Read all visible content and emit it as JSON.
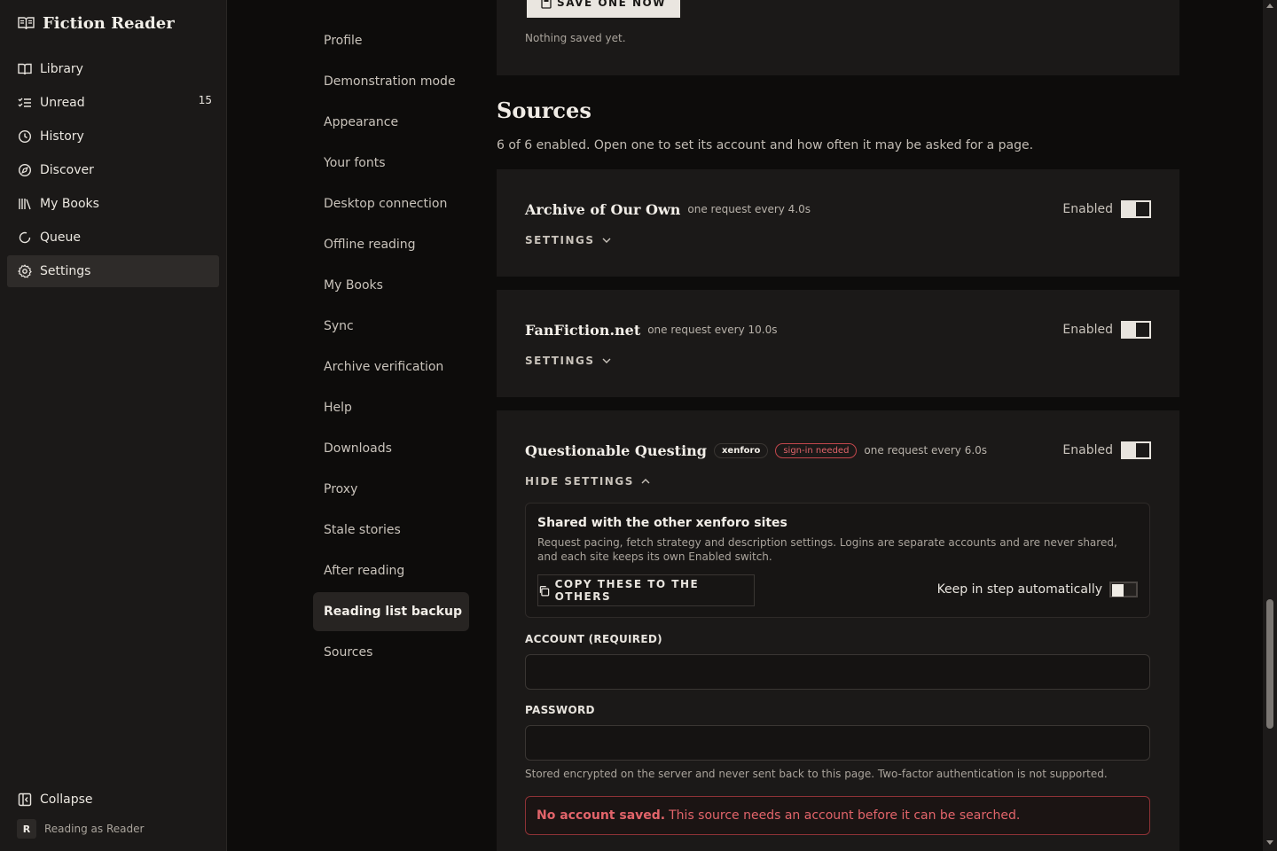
{
  "app": {
    "title": "Fiction Reader"
  },
  "sidebar": {
    "items": [
      {
        "label": "Library",
        "icon": "book-open-icon"
      },
      {
        "label": "Unread",
        "icon": "list-check-icon",
        "count": "15"
      },
      {
        "label": "History",
        "icon": "clock-icon"
      },
      {
        "label": "Discover",
        "icon": "compass-icon"
      },
      {
        "label": "My Books",
        "icon": "bookshelf-icon"
      },
      {
        "label": "Queue",
        "icon": "refresh-icon"
      },
      {
        "label": "Settings",
        "icon": "gear-icon",
        "active": true
      }
    ],
    "collapse_label": "Collapse",
    "user_initial": "R",
    "reading_as": "Reading as Reader"
  },
  "settings_nav": {
    "items": [
      "Profile",
      "Demonstration mode",
      "Appearance",
      "Your fonts",
      "Desktop connection",
      "Offline reading",
      "My Books",
      "Sync",
      "Archive verification",
      "Help",
      "Downloads",
      "Proxy",
      "Stale stories",
      "After reading",
      "Reading list backup",
      "Sources"
    ],
    "active": "Reading list backup"
  },
  "backup": {
    "save_button": "SAVE ONE NOW",
    "status": "Nothing saved yet."
  },
  "sources": {
    "title": "Sources",
    "description": "6 of 6 enabled. Open one to set its account and how often it may be asked for a page.",
    "enabled_label": "Enabled",
    "list": [
      {
        "name": "Archive of Our Own",
        "rate": "one request every 4.0s",
        "settings_label": "SETTINGS",
        "enabled": true
      },
      {
        "name": "FanFiction.net",
        "rate": "one request every 10.0s",
        "settings_label": "SETTINGS",
        "enabled": true
      },
      {
        "name": "Questionable Questing",
        "tag": "xenforo",
        "warning": "sign-in needed",
        "rate": "one request every 6.0s",
        "settings_label": "HIDE SETTINGS",
        "enabled": true
      }
    ],
    "shared": {
      "title": "Shared with the other xenforo sites",
      "description": "Request pacing, fetch strategy and description settings. Logins are separate accounts and are never shared, and each site keeps its own Enabled switch.",
      "copy_button": "COPY THESE TO THE OTHERS",
      "keep_label": "Keep in step automatically",
      "keep_on": false
    },
    "account": {
      "label": "ACCOUNT (REQUIRED)",
      "value": ""
    },
    "password": {
      "label": "PASSWORD",
      "value": "",
      "help": "Stored encrypted on the server and never sent back to this page. Two-factor authentication is not supported."
    },
    "alert": {
      "strong": "No account saved.",
      "text": "This source needs an account before it can be searched."
    }
  }
}
